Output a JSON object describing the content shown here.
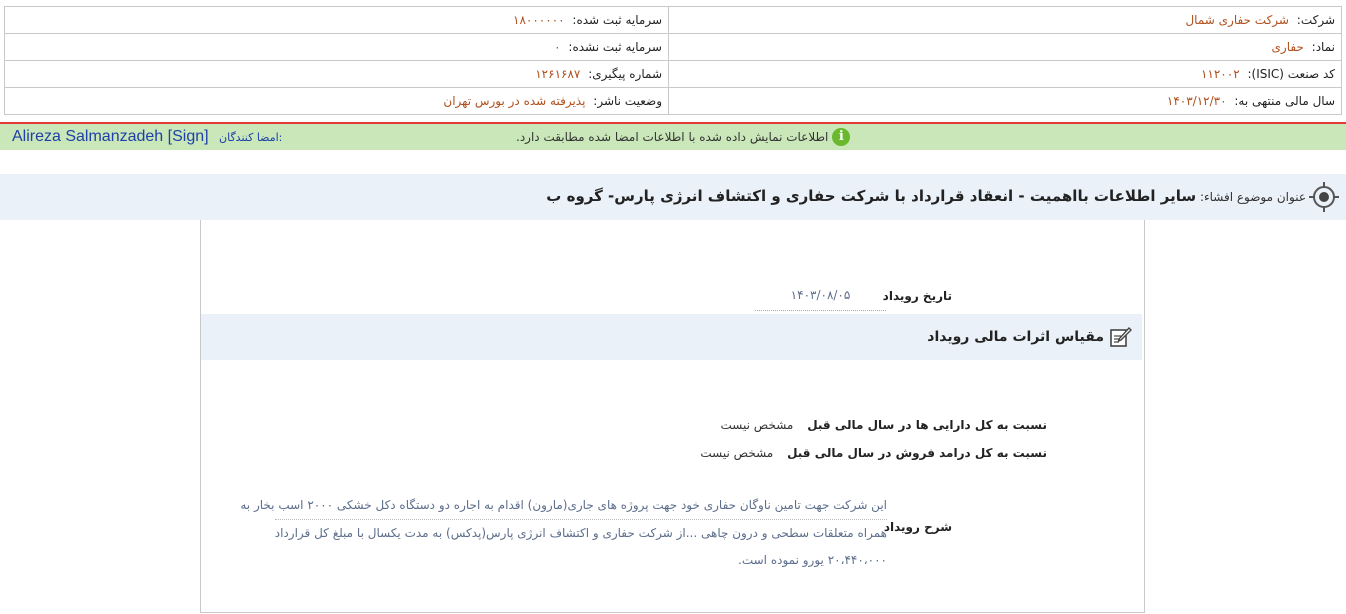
{
  "company_info": {
    "company_label": "شرکت:",
    "company_value": "شرکت حفاری شمال",
    "symbol_label": "نماد:",
    "symbol_value": "حفاری",
    "isic_label": "کد صنعت (ISIC):",
    "isic_value": "۱۱۲۰۰۲",
    "fiscal_year_label": "سال مالی منتهی به:",
    "fiscal_year_value": "۱۴۰۳/۱۲/۳۰",
    "registered_capital_label": "سرمایه ثبت شده:",
    "registered_capital_value": "۱۸۰۰۰۰۰۰",
    "unregistered_capital_label": "سرمایه ثبت نشده:",
    "unregistered_capital_value": "۰",
    "tracking_label": "شماره پیگیری:",
    "tracking_value": "۱۲۶۱۶۸۷",
    "publisher_status_label": "وضعیت ناشر:",
    "publisher_status_value": "پذیرفته شده در بورس تهران"
  },
  "signature_bar": {
    "signers_label": "امضا کنندگان:",
    "signers_value": "Alireza Salmanzadeh [Sign]",
    "notice": "اطلاعات نمایش داده شده با اطلاعات امضا شده مطابقت دارد.",
    "info_icon": "info-icon",
    "accent_color": "#c9e7b9",
    "line_color": "#e53935"
  },
  "subject": {
    "label": "عنوان موضوع افشاء:",
    "title": "سایر اطلاعات بااهمیت - انعقاد قرارداد با شرکت حفاری و اکتشاف انرژی پارس- گروه ب",
    "icon": "target-icon"
  },
  "event": {
    "date_label": "تاریخ رویداد",
    "date_value": "۱۴۰۳/۰۸/۰۵",
    "impact_title": "مقیاس اثرات مالی رویداد",
    "impact_icon": "edit-icon",
    "assets_ratio_label": "نسبت به کل دارایی ها در سال مالی قبل",
    "assets_ratio_value": "مشخص نیست",
    "revenue_ratio_label": "نسبت به کل درامد فروش در سال مالی قبل",
    "revenue_ratio_value": "مشخص نیست",
    "description_label": "شرح رویداد",
    "description_lines": [
      "این شرکت جهت تامین ناوگان حفاری خود جهت پروژه های جاری(مارون) اقدام به اجاره دو دستگاه دکل خشکی ۲۰۰۰ اسب بخار به",
      "همراه متعلقات سطحی و درون چاهی ...از شرکت حفاری و اکتشاف انرژی پارس(پدکس) به مدت یکسال با مبلغ کل قرارداد",
      "۲۰،۴۴۰،۰۰۰ یورو نموده است."
    ]
  }
}
